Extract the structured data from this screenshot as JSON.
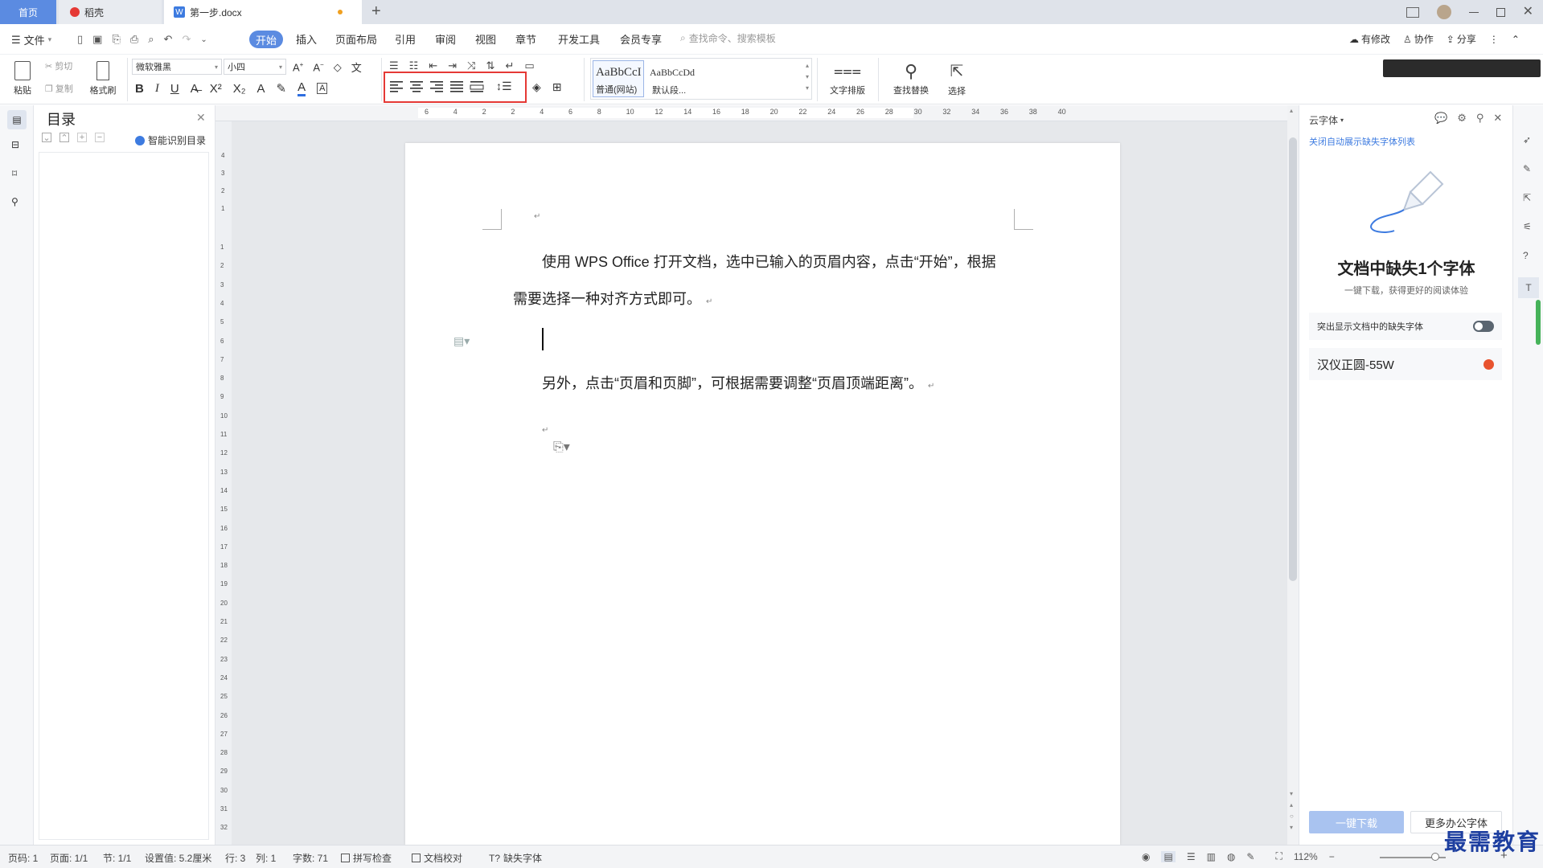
{
  "titlebar": {
    "tabs": [
      {
        "label": "首页"
      },
      {
        "label": "稻壳"
      },
      {
        "label": "第一步.docx"
      }
    ],
    "new_tab": "+"
  },
  "menubar": {
    "file_menu": "文件",
    "items": [
      "开始",
      "插入",
      "页面布局",
      "引用",
      "审阅",
      "视图",
      "章节",
      "开发工具",
      "会员专享"
    ],
    "search_placeholder": "查找命令、搜索模板",
    "right": {
      "revise": "有修改",
      "collab": "协作",
      "share": "分享"
    }
  },
  "ribbon": {
    "paste": "粘贴",
    "cut": "剪切",
    "copy": "复制",
    "format_painter": "格式刷",
    "font_name": "微软雅黑",
    "font_size": "小四",
    "bold": "B",
    "italic": "I",
    "underline": "U",
    "styles": [
      {
        "preview": "AaBbCcI",
        "name": "普通(网站)"
      },
      {
        "preview": "AaBbCcDd",
        "name": "默认段..."
      }
    ],
    "text_layout": "文字排版",
    "find_replace": "查找替换",
    "select": "选择",
    "highlight_color": "#e53935"
  },
  "ruler": {
    "h_ticks": [
      "6",
      "4",
      "2",
      "2",
      "4",
      "6",
      "8",
      "10",
      "12",
      "14",
      "16",
      "18",
      "20",
      "22",
      "24",
      "26",
      "28",
      "30",
      "32",
      "34",
      "36",
      "38",
      "40"
    ],
    "v_ticks_top": [
      "4",
      "3",
      "2",
      "1"
    ],
    "v_ticks": [
      "1",
      "2",
      "3",
      "4",
      "5",
      "6",
      "7",
      "8",
      "9",
      "10",
      "11",
      "12",
      "13",
      "14",
      "15",
      "16",
      "17",
      "18",
      "19",
      "20",
      "21",
      "22",
      "23",
      "24",
      "25",
      "26",
      "27",
      "28",
      "29",
      "30",
      "31",
      "32"
    ]
  },
  "navpane": {
    "title": "目录",
    "smart_toc": "智能识别目录"
  },
  "document": {
    "para1_line1": "使用 WPS Office 打开文档，选中已输入的页眉内容，点击“开始”，根据",
    "para1_line2": "需要选择一种对齐方式即可。",
    "para2": "另外，点击“页眉和页脚”，可根据需要调整“页眉顶端距离”。",
    "para_mark": "↵"
  },
  "sidepanel": {
    "header": "云字体",
    "close_auto": "关闭自动展示缺失字体列表",
    "missing_title": "文档中缺失1个字体",
    "missing_sub": "一键下载，获得更好的阅读体验",
    "highlight_toggle": "突出显示文档中的缺失字体",
    "font_item": "汉仪正圆-55W",
    "download_btn": "一键下载",
    "more_btn": "更多办公字体"
  },
  "statusbar": {
    "page": "页码: 1",
    "pages": "页面: 1/1",
    "section": "节: 1/1",
    "setting": "设置值: 5.2厘米",
    "row": "行: 3",
    "col": "列: 1",
    "words": "字数: 71",
    "spell": "拼写检查",
    "proof": "文档校对",
    "missing_font": "缺失字体",
    "zoom": "112%"
  },
  "watermark": "最需教育",
  "colors": {
    "accent": "#5b8be1",
    "toggle_off": "#5a6570"
  }
}
